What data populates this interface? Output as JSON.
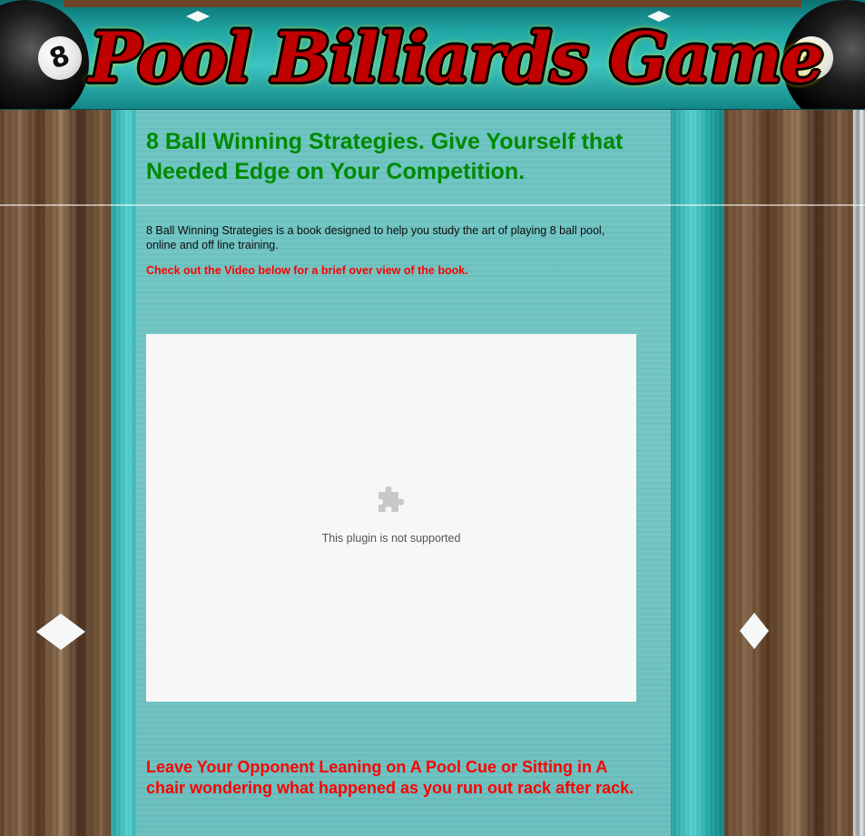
{
  "header": {
    "logo_text": "Pool Billiards Game",
    "ball_number": "8"
  },
  "main": {
    "headline": "8 Ball Winning Strategies. Give Yourself that Needed Edge on Your Competition.",
    "intro": "8 Ball Winning Strategies is a book designed to help you study the art of playing 8 ball pool, online and off line training.",
    "video_note": "Check out the Video below for a brief over view of the book.",
    "plugin_message": "This plugin is not supported",
    "tagline": "Leave Your Opponent Leaning on A Pool Cue or Sitting in A chair wondering what happened as you run out rack after rack."
  },
  "colors": {
    "headline": "#008a00",
    "accent_red": "#ff0000",
    "logo_red": "#c10000",
    "felt": "#6cc4c2"
  },
  "icons": {
    "plugin": "puzzle-piece-icon"
  }
}
